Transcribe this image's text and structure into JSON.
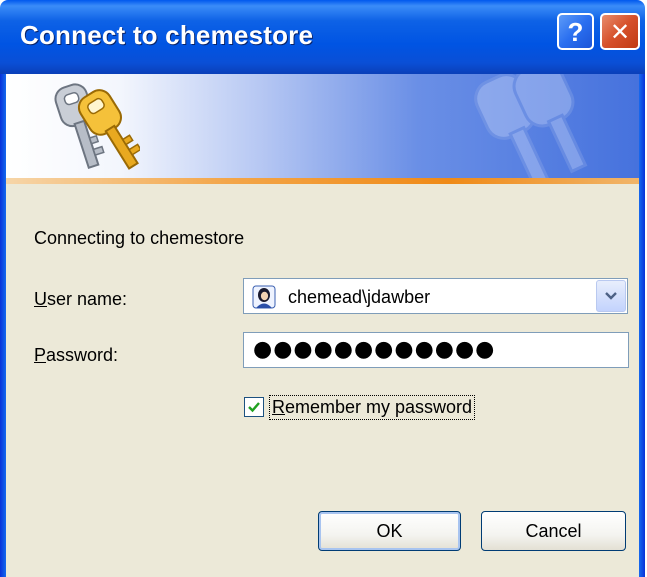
{
  "window": {
    "title": "Connect to chemestore",
    "help_label": "?",
    "close_label": "✕"
  },
  "banner": {
    "icon": "keys-icon",
    "watermark_icon": "keys-watermark-icon",
    "accent_color": "#ef8a17"
  },
  "form": {
    "connecting_text": "Connecting to chemestore",
    "user_label_access": "U",
    "user_label_rest": "ser name:",
    "user_value": "chemead\\jdawber",
    "user_icon": "user-account-icon",
    "password_label_access": "P",
    "password_label_rest": "assword:",
    "password_mask": "●●●●●●●●●●●●",
    "remember_label_access": "R",
    "remember_label_rest": "emember my password",
    "remember_checked": true
  },
  "buttons": {
    "ok_label": "OK",
    "cancel_label": "Cancel"
  }
}
